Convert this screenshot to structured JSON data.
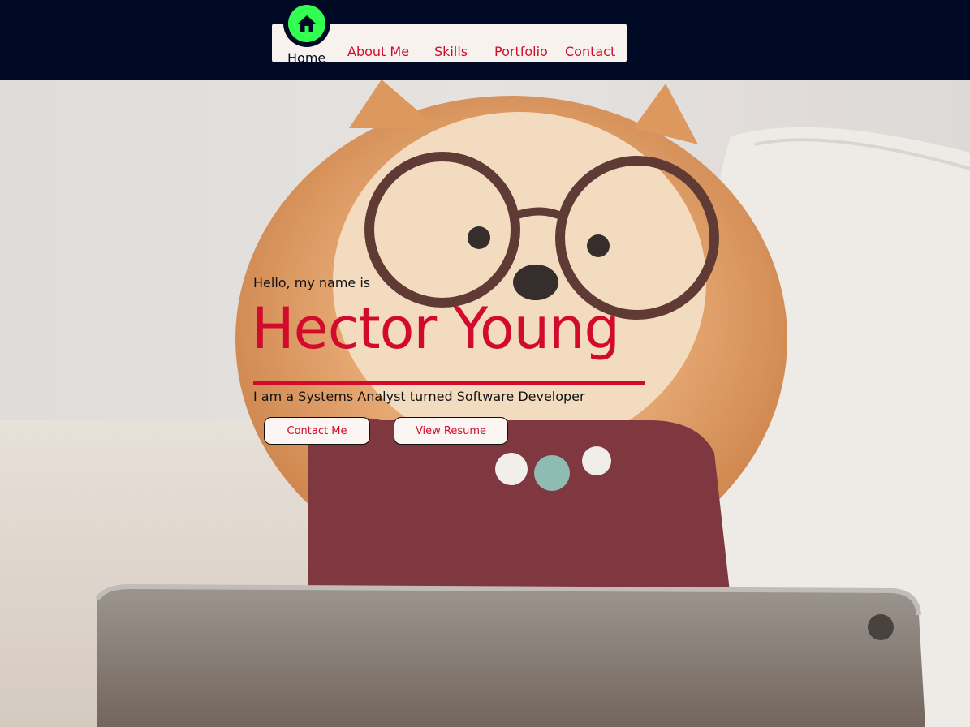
{
  "nav": {
    "items": [
      {
        "label": "Home",
        "icon": "home-icon"
      },
      {
        "label": "About Me"
      },
      {
        "label": "Skills"
      },
      {
        "label": "Portfolio"
      },
      {
        "label": "Contact"
      }
    ],
    "active_color": "#33ff52",
    "bg_color": "#000a24"
  },
  "hero": {
    "greeting": "Hello, my name is",
    "name": "Hector Young",
    "tagline": "I am a Systems Analyst turned Software Developer",
    "buttons": {
      "contact": "Contact Me",
      "resume": "View Resume"
    },
    "background_image": "pomeranian-dog-with-glasses-and-tablet",
    "accent_color": "#d20a2e"
  }
}
